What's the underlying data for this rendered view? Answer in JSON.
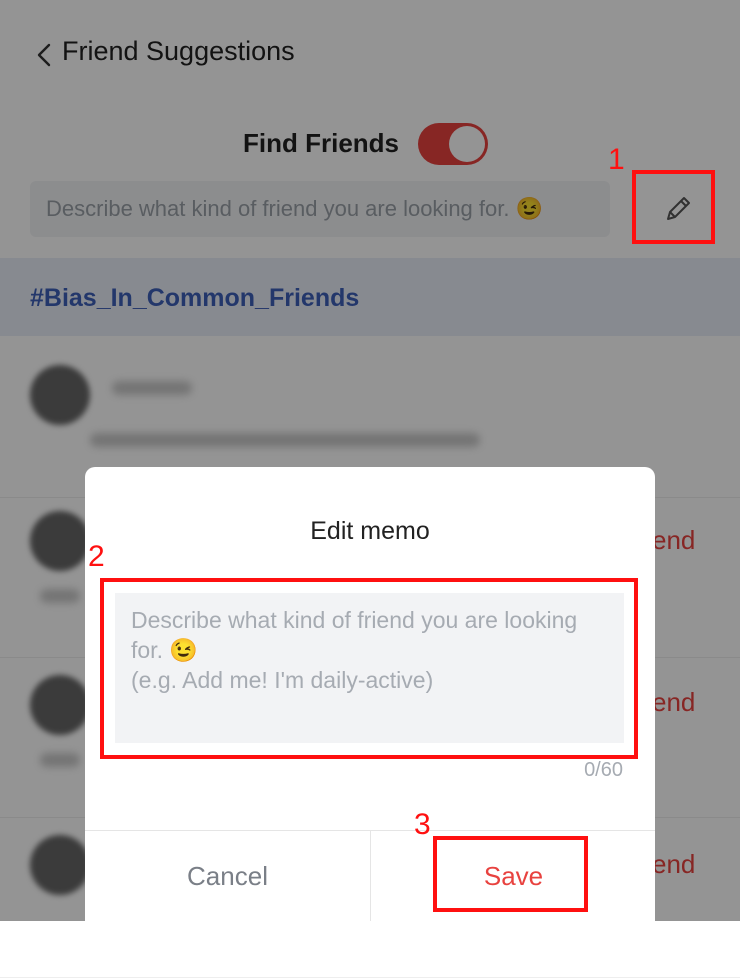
{
  "header": {
    "title": "Friend Suggestions",
    "back_icon": "chevron-left-icon"
  },
  "find_friends": {
    "label": "Find Friends",
    "toggle_on": true,
    "toggle_color": "#e8423f"
  },
  "memo_bar": {
    "placeholder": "Describe what kind of friend you are looking for. 😉",
    "edit_icon": "pencil-icon"
  },
  "hashtag": {
    "text": "#Bias_In_Common_Friends",
    "color": "#3d5fb8"
  },
  "list": {
    "rows": [
      {
        "action": ""
      },
      {
        "action": "end"
      },
      {
        "action": "end"
      },
      {
        "action": "end"
      }
    ]
  },
  "dialog": {
    "title": "Edit memo",
    "input_value": "",
    "input_placeholder": "Describe what kind of friend you are looking for. 😉\n(e.g. Add me! I'm daily-active)",
    "char_count": "0/60",
    "cancel_label": "Cancel",
    "save_label": "Save"
  },
  "annotations": {
    "color": "#ff1010",
    "labels": [
      "1",
      "2",
      "3"
    ]
  }
}
